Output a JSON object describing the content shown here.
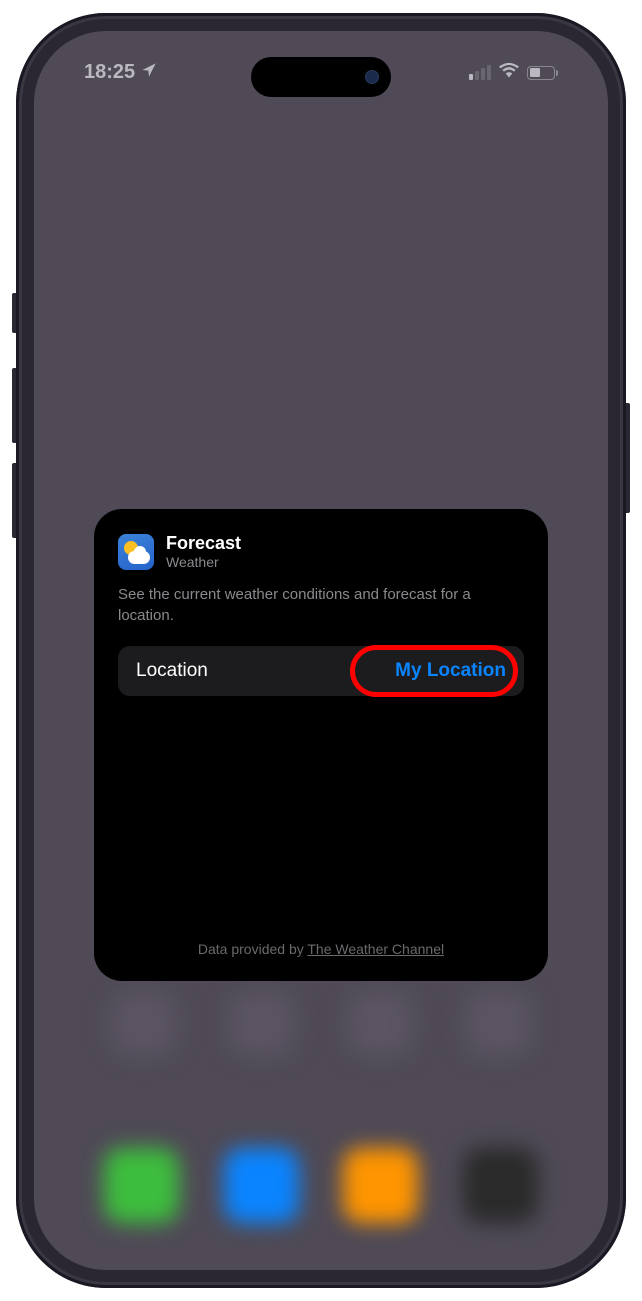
{
  "status_bar": {
    "time": "18:25"
  },
  "widget": {
    "title": "Forecast",
    "subtitle": "Weather",
    "description": "See the current weather conditions and forecast for a location.",
    "location_row": {
      "label": "Location",
      "value": "My Location"
    },
    "footer": {
      "prefix": "Data provided by ",
      "link": "The Weather Channel"
    }
  }
}
